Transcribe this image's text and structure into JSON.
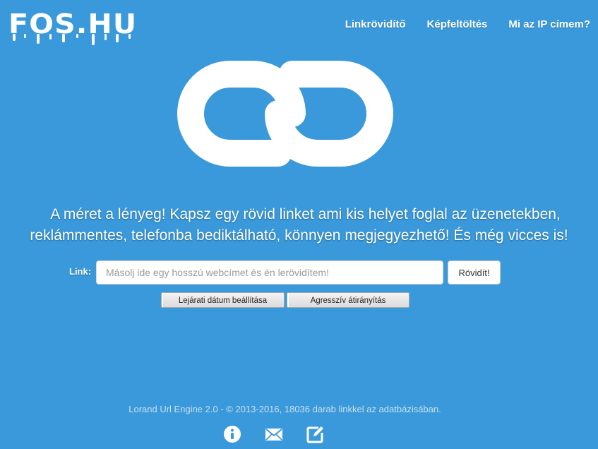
{
  "header": {
    "logo_text": "FOS.HU",
    "nav": [
      {
        "label": "Linkrövidítő"
      },
      {
        "label": "Képfeltöltés"
      },
      {
        "label": "Mi az IP címem?"
      }
    ]
  },
  "hero": {
    "icon": "chain-link-icon",
    "tagline_line1": "A méret a lényeg! Kapsz egy rövid linket ami kis helyet foglal az üzenetekben,",
    "tagline_line2": "reklámmentes, telefonba bediktálható, könnyen megjegyezhető! És még vicces is!"
  },
  "form": {
    "label": "Link:",
    "input_value": "",
    "input_placeholder": "Másolj ide egy hosszú webcímet és én lerövidítem!",
    "submit_label": "Rövidít!",
    "option_expire": "Lejárati dátum beállítása",
    "option_aggressive": "Agresszív átirányítás"
  },
  "footer": {
    "text": "Lorand Url Engine 2.0 - © 2013-2016, 18036 darab linkkel az adatbázisában.",
    "icons": [
      "info-icon",
      "mail-icon",
      "edit-icon"
    ]
  },
  "colors": {
    "background": "#3a99da",
    "text": "#ffffff",
    "footer_text": "#c9dff0"
  }
}
